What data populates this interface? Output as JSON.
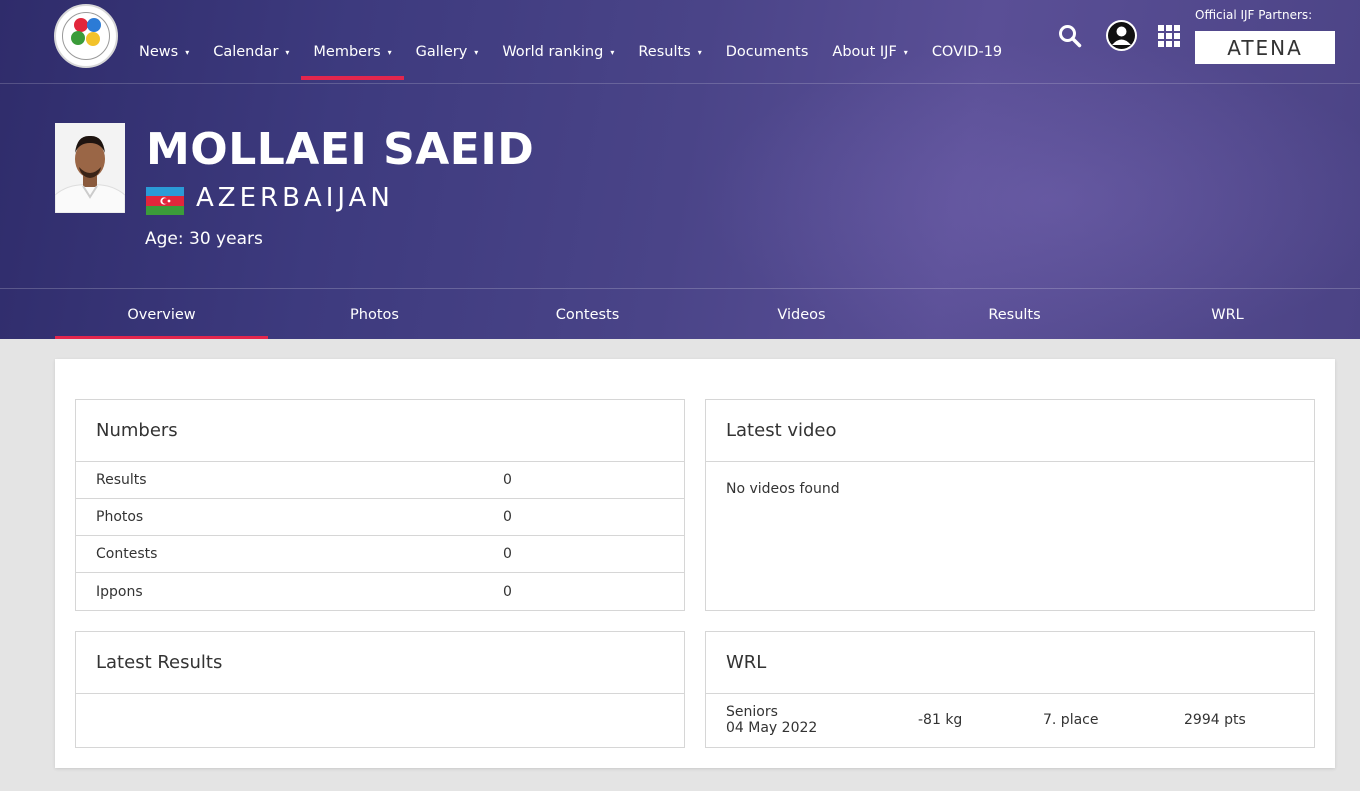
{
  "nav": {
    "items": [
      {
        "label": "News",
        "caret": "▾"
      },
      {
        "label": "Calendar",
        "caret": "▾"
      },
      {
        "label": "Members",
        "caret": "▾"
      },
      {
        "label": "Gallery",
        "caret": "▾"
      },
      {
        "label": "World ranking",
        "caret": "▾"
      },
      {
        "label": "Results",
        "caret": "▾"
      },
      {
        "label": "Documents",
        "caret": ""
      },
      {
        "label": "About IJF",
        "caret": "▾"
      },
      {
        "label": "COVID-19",
        "caret": ""
      }
    ],
    "active": "Members"
  },
  "partners": {
    "label": "Official IJF Partners:",
    "partner_name": "ATENA"
  },
  "profile": {
    "name": "MOLLAEI SAEID",
    "country": "AZERBAIJAN",
    "age": "Age: 30 years"
  },
  "tabs": [
    {
      "label": "Overview"
    },
    {
      "label": "Photos"
    },
    {
      "label": "Contests"
    },
    {
      "label": "Videos"
    },
    {
      "label": "Results"
    },
    {
      "label": "WRL"
    }
  ],
  "numbers": {
    "title": "Numbers",
    "rows": [
      {
        "label": "Results",
        "value": "0"
      },
      {
        "label": "Photos",
        "value": "0"
      },
      {
        "label": "Contests",
        "value": "0"
      },
      {
        "label": "Ippons",
        "value": "0"
      }
    ]
  },
  "latest_video": {
    "title": "Latest video",
    "empty": "No videos found"
  },
  "latest_results": {
    "title": "Latest Results"
  },
  "wrl": {
    "title": "WRL",
    "category": "Seniors",
    "date": "04 May 2022",
    "weight": "-81 kg",
    "place": "7. place",
    "points": "2994 pts"
  },
  "colors": {
    "accent": "#e3264d",
    "hero_dark": "#2f2c6b",
    "hero_light": "#5a4f96"
  }
}
